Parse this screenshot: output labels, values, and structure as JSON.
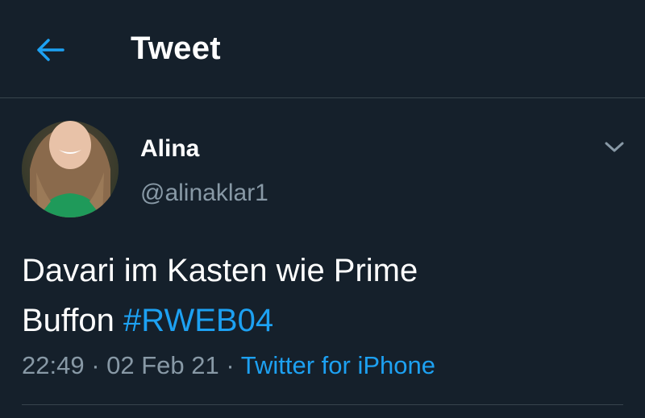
{
  "header": {
    "title": "Tweet",
    "back_icon": "arrow-left-icon"
  },
  "tweet": {
    "author": {
      "name": "Alina",
      "handle": "@alinaklar1",
      "avatar_icon": "user-avatar"
    },
    "more_icon": "chevron-down-icon",
    "text_line1": "Davari im Kasten wie Prime",
    "text_line2": "Buffon ",
    "hashtag": "#RWEB04",
    "time": "22:49",
    "separator1": " · ",
    "date": "02 Feb 21",
    "separator2": " · ",
    "source": "Twitter for iPhone"
  },
  "colors": {
    "background": "#15202b",
    "accent": "#1da1f2",
    "secondary_text": "#8899a6",
    "divider": "#38444d",
    "primary_text": "#ffffff"
  }
}
